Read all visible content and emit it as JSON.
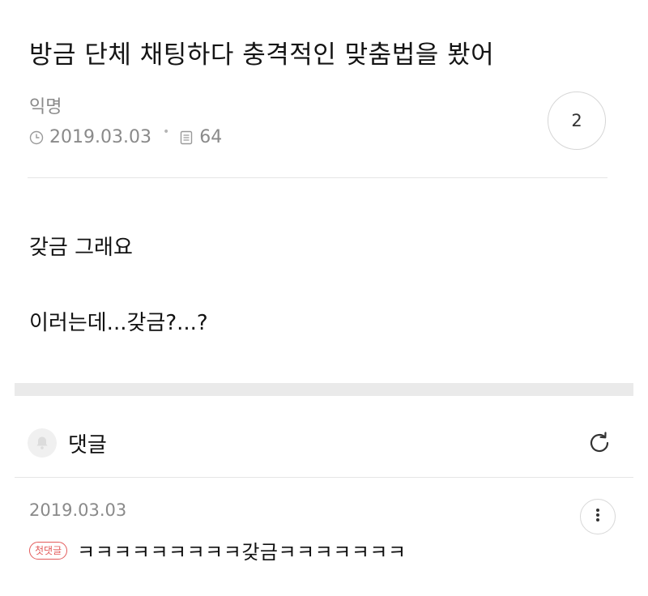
{
  "post": {
    "title": "방금 단체 채팅하다 충격적인 맞춤법을 봤어",
    "author": "익명",
    "date": "2019.03.03",
    "views": "64",
    "comment_count": "2",
    "body_lines": [
      "갖금 그래요",
      "이러는데...갖금?...?"
    ]
  },
  "comments_section": {
    "label": "댓글",
    "icons": {
      "header": "bell-icon",
      "refresh": "refresh-icon",
      "more": "more-vertical-icon"
    }
  },
  "comments": [
    {
      "date": "2019.03.03",
      "badge": "첫댓글",
      "text": "ㅋㅋㅋㅋㅋㅋㅋㅋㅋ갖금ㅋㅋㅋㅋㅋㅋㅋ"
    }
  ],
  "colors": {
    "badge": "#e35b5b",
    "muted_text": "#8a8a8a",
    "divider": "#e6e6e6",
    "band": "#eaeaea"
  }
}
